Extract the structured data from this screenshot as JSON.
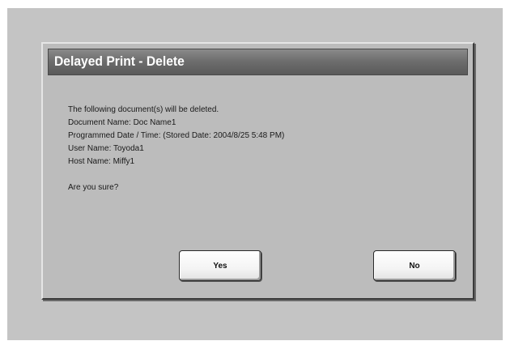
{
  "dialog": {
    "title": "Delayed Print - Delete",
    "message_lines": [
      "The following document(s) will be deleted.",
      "Document Name: Doc Name1",
      "Programmed Date / Time: (Stored Date: 2004/8/25 5:48 PM)",
      "User Name: Toyoda1",
      "Host Name: Miffy1"
    ],
    "confirm_prompt": "Are you sure?",
    "buttons": {
      "yes_label": "Yes",
      "no_label": "No"
    }
  }
}
